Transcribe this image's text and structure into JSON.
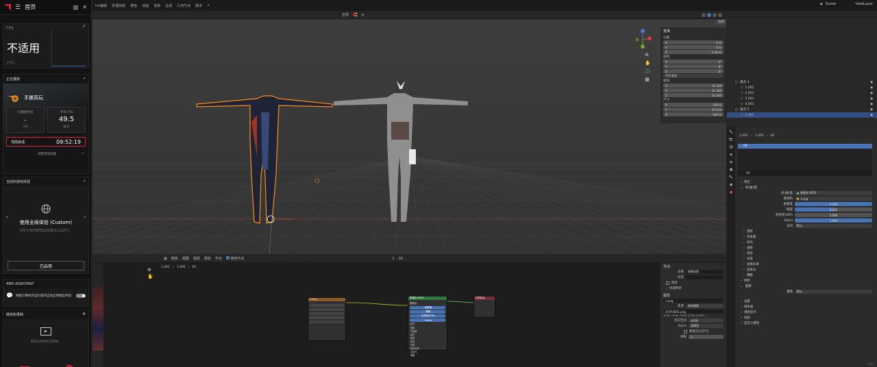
{
  "amd": {
    "title": "首页",
    "fps_label": "FPS",
    "fps_value": "不适用",
    "fps_sub": "FPS",
    "now_playing_label": "正在播放",
    "game_name": "手搓高玩",
    "played_label": "已播放时间",
    "played_value": "-",
    "played_unit": "小时",
    "avg_fps_label": "平均 FPS",
    "avg_fps_value": "49.5",
    "avg_fps_unit": "帧/秒",
    "session_label": "当前会话",
    "session_value": "09:52:19",
    "adjust_label": "调整游戏配置",
    "experience_label": "当前的游戏体验",
    "experience_title": "使用全局体验 (Custom)",
    "experience_desc": "您定义体验使用自动配置可以自定义。",
    "enabled_button": "已启用",
    "assistant_label": "AMD ASSISTANT",
    "assistant_desc": "根据计算机的运行操作自动启用相应体验",
    "media_label": "媒体和录制",
    "media_empty": "目前未录制任何媒体。"
  },
  "blender": {
    "menu": [
      "UV编辑",
      "纹理绘制",
      "着色",
      "动画",
      "渲染",
      "合成",
      "几何节点",
      "脚本",
      "+"
    ],
    "scene_label": "Scene",
    "viewlayer_label": "ViewLayer",
    "viewport_header": [
      "全局",
      "选项"
    ],
    "transform": {
      "title": "变换",
      "location_label": "位置:",
      "location": [
        [
          "X",
          "0 m"
        ],
        [
          "Y",
          "0 m"
        ],
        [
          "Z",
          "-1.24 m"
        ]
      ],
      "rotation_label": "旋转:",
      "rotation": [
        [
          "X",
          "0°"
        ],
        [
          "Y",
          "0°"
        ],
        [
          "Z",
          "0°"
        ]
      ],
      "mode": "XYZ 欧拉",
      "scale_label": "缩放:",
      "scale": [
        [
          "X",
          "11.344"
        ],
        [
          "Y",
          "11.344"
        ],
        [
          "Z",
          "11.344"
        ]
      ],
      "dims_label": "尺寸:",
      "dims": [
        [
          "X",
          "159 m"
        ],
        [
          "Y",
          "47.3 m"
        ],
        [
          "Z",
          "149 m"
        ]
      ]
    },
    "outliner": [
      {
        "name": "集合 4",
        "indent": 0
      },
      {
        "name": "1.002",
        "indent": 1
      },
      {
        "name": "2.001",
        "indent": 1
      },
      {
        "name": "3.001",
        "indent": 1
      },
      {
        "name": "4.001",
        "indent": 1
      },
      {
        "name": "集合 5",
        "indent": 0
      },
      {
        "name": "1.001",
        "indent": 1
      }
    ],
    "props_breadcrumb": [
      "1.001",
      "1.005",
      "00"
    ],
    "material_slot": "00",
    "material_name": "00",
    "props": {
      "preview": "预览",
      "surface": "表(曲)面",
      "surface_value": "原理化 BSDF",
      "base_color_label": "基础色",
      "base_color_value": "1.png",
      "metallic_label": "金属度",
      "metallic_value": "0.000",
      "roughness_label": "糙度",
      "roughness_value": "0.500",
      "ior_label": "折射率(IOR)",
      "ior_value": "1.000",
      "alpha_label": "Alpha",
      "alpha_value": "1.000",
      "normal_label": "法向",
      "normal_value": "默认",
      "sections": [
        "漫射",
        "次表面",
        "高光",
        "透射",
        "涂层",
        "光泽",
        "边缘光泽",
        "自发光",
        "薄膜"
      ],
      "volume": "体积",
      "displacement": "置换",
      "disp_label": "置换",
      "disp_value": "默认",
      "settings": [
        "设置",
        "线条画",
        "视图显示",
        "动画",
        "自定义属性"
      ]
    },
    "node_header": [
      "物体",
      "视图",
      "选择",
      "添加",
      "节点",
      "使用节点"
    ],
    "node_breadcrumb": [
      "1.001",
      "1.005",
      "00"
    ],
    "node_top_right": [
      "1",
      "00"
    ],
    "node_sidebar": {
      "node_title": "节点",
      "name_label": "名称",
      "name_value": "图像纹理",
      "label_label": "标签",
      "color": "颜色",
      "props_title": "属性",
      "image": "1.png",
      "source_label": "来源",
      "source_value": "单张图像",
      "file": "2C6Y4DS1.png",
      "file_info": "4096 x 4096, RGBA 字节型 (8038B...)",
      "colorspace_label": "色彩空间",
      "colorspace_value": "sRGB",
      "alpha_label": "Alpha",
      "alpha_value": "直通型",
      "pack": "数据包/已打包",
      "frames_label": "帧数",
      "frames_value": "1",
      "texture_mapping": "纹理映射"
    },
    "nodes": {
      "image_title": "1.png",
      "bsdf_title": "原理化 BSDF",
      "output_title": "材质输出",
      "bsdf_fields": [
        "基础色",
        "金属度",
        "糙度",
        "折射率(IOR)",
        "Alpha",
        "法向"
      ],
      "bsdf_sections": [
        "漫射",
        "次表面",
        "高光",
        "透射",
        "涂层",
        "光泽",
        "边缘光泽",
        "自发光",
        "薄膜"
      ]
    },
    "version": "4.0.2"
  },
  "colors": {
    "accent_blue": "#4772b3",
    "amd_red": "#e0203a",
    "select_orange": "#ff8c1a"
  }
}
